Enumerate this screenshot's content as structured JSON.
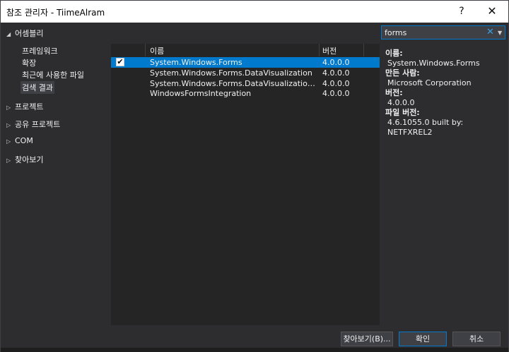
{
  "window": {
    "title": "참조 관리자 - TiimeAlram",
    "help": "?",
    "close": "✕"
  },
  "nav": {
    "groups": [
      {
        "label": "어셈블리",
        "arrow": "◢"
      },
      {
        "label": "프로젝트",
        "arrow": "▷"
      },
      {
        "label": "공유 프로젝트",
        "arrow": "▷"
      },
      {
        "label": "COM",
        "arrow": "▷"
      },
      {
        "label": "찾아보기",
        "arrow": "▷"
      }
    ],
    "assembly_items": [
      {
        "label": "프레임워크"
      },
      {
        "label": "확장"
      },
      {
        "label": "최근에 사용한 파일"
      },
      {
        "label": "검색 결과"
      }
    ]
  },
  "list": {
    "headers": {
      "name": "이름",
      "version": "버전"
    },
    "rows": [
      {
        "name": "System.Windows.Forms",
        "version": "4.0.0.0",
        "checked": "✔"
      },
      {
        "name": "System.Windows.Forms.DataVisualization",
        "version": "4.0.0.0",
        "checked": ""
      },
      {
        "name": "System.Windows.Forms.DataVisualization.Design",
        "version": "4.0.0.0",
        "checked": ""
      },
      {
        "name": "WindowsFormsIntegration",
        "version": "4.0.0.0",
        "checked": ""
      }
    ]
  },
  "search": {
    "value": "forms",
    "clear": "✕",
    "dropdown": "▼"
  },
  "details": {
    "name_label": "이름:",
    "name_value": "System.Windows.Forms",
    "author_label": "만든 사람:",
    "author_value": "Microsoft Corporation",
    "version_label": "버전:",
    "version_value": "4.0.0.0",
    "file_version_label": "파일 버전:",
    "file_version_value": "4.6.1055.0 built by: NETFXREL2"
  },
  "buttons": {
    "browse": "찾아보기(B)...",
    "ok": "확인",
    "cancel": "취소"
  },
  "colors": {
    "accent": "#007acc",
    "background": "#2d2d30",
    "list_background": "#252526"
  }
}
